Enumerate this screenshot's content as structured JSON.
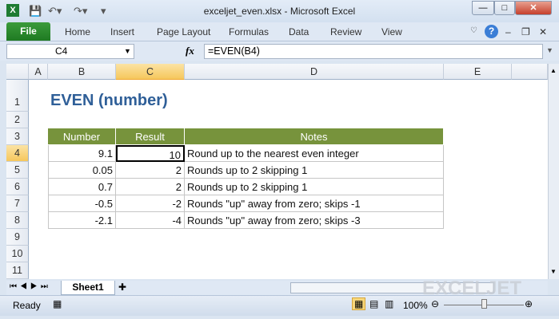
{
  "window": {
    "title": "exceljet_even.xlsx  -  Microsoft Excel"
  },
  "ribbon": {
    "file": "File",
    "tabs": [
      "Home",
      "Insert",
      "Page Layout",
      "Formulas",
      "Data",
      "Review",
      "View"
    ]
  },
  "formula_bar": {
    "name_box": "C4",
    "fx": "fx",
    "formula": "=EVEN(B4)"
  },
  "columns": [
    "A",
    "B",
    "C",
    "D",
    "E"
  ],
  "rows": [
    "1",
    "2",
    "3",
    "4",
    "5",
    "6",
    "7",
    "8",
    "9",
    "10",
    "11"
  ],
  "sheet": {
    "heading": "EVEN (number)",
    "table": {
      "headers": [
        "Number",
        "Result",
        "Notes"
      ],
      "rows": [
        [
          "9.1",
          "10",
          "Round up to the nearest even integer"
        ],
        [
          "0.05",
          "2",
          "Rounds up to 2 skipping 1"
        ],
        [
          "0.7",
          "2",
          "Rounds up to 2 skipping 1"
        ],
        [
          "-0.5",
          "-2",
          "Rounds \"up\" away from zero; skips -1"
        ],
        [
          "-2.1",
          "-4",
          "Rounds \"up\" away from zero; skips -3"
        ]
      ]
    }
  },
  "sheet_tabs": [
    "Sheet1"
  ],
  "status": {
    "ready": "Ready",
    "zoom": "100%",
    "zoom_fraction": 0.5
  },
  "watermark": "EXCELJET"
}
